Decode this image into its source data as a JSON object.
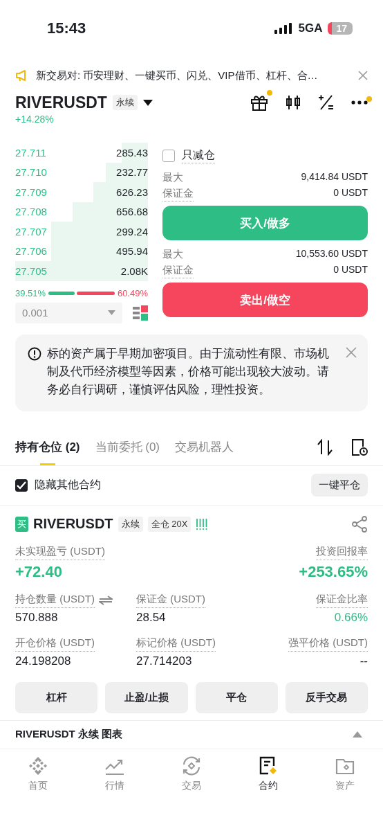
{
  "status_bar": {
    "time": "15:43",
    "network": "5GA",
    "battery": "17"
  },
  "announcement": {
    "text": "新交易对: 币安理财、一键买币、闪兑、VIP借币、杠杆、合…"
  },
  "header": {
    "symbol": "RIVERUSDT",
    "tag": "永续",
    "change": "+14.28%",
    "actions": [
      {
        "dot": true
      },
      {
        "dot": false
      },
      {
        "dot": false
      },
      {
        "dot": true
      }
    ]
  },
  "order_book": {
    "rows": [
      {
        "price": "27.711",
        "amount": "285.43"
      },
      {
        "price": "27.710",
        "amount": "232.77"
      },
      {
        "price": "27.709",
        "amount": "626.23"
      },
      {
        "price": "27.708",
        "amount": "656.68"
      },
      {
        "price": "27.707",
        "amount": "299.24"
      },
      {
        "price": "27.706",
        "amount": "495.94"
      },
      {
        "price": "27.705",
        "amount": "2.08K"
      }
    ],
    "buy_pct": "39.51%",
    "sell_pct": "60.49%",
    "ratio": {
      "level": 0.3951
    },
    "precision": "0.001"
  },
  "order_form": {
    "reduce_only": {
      "label": "只减仓",
      "checked": false
    },
    "sides": [
      {
        "kind": "buy",
        "max_label": "最大",
        "max_value": "9,414.84 USDT",
        "margin_label": "保证金",
        "margin_value": "0 USDT",
        "button": "买入/做多"
      },
      {
        "kind": "sell",
        "max_label": "最大",
        "max_value": "10,553.60 USDT",
        "margin_label": "保证金",
        "margin_value": "0 USDT",
        "button": "卖出/做空"
      }
    ]
  },
  "notice": {
    "text": "标的资产属于早期加密项目。由于流动性有限、市场机制及代币经济模型等因素，价格可能出现较大波动。请务必自行调研，谨慎评估风险，理性投资。"
  },
  "tabs": [
    {
      "label": "持有仓位 (2)",
      "selected": true
    },
    {
      "label": "当前委托 (0)",
      "selected": false
    },
    {
      "label": "交易机器人",
      "selected": false
    }
  ],
  "hide_others": {
    "label": "隐藏其他合约",
    "checked": true
  },
  "close_all_button": "一键平仓",
  "position": {
    "side": "买",
    "symbol": "RIVERUSDT",
    "tags": [
      "永续",
      "全仓 20X"
    ],
    "rows": [
      [
        {
          "label": "未实现盈亏 (USDT)",
          "value": "+72.40",
          "positive": true,
          "kind": "large",
          "swap": false
        },
        "",
        {
          "label": "投资回报率",
          "value": "+253.65%",
          "positive": true,
          "kind": "large",
          "swap": false
        }
      ],
      [
        {
          "label": "持仓数量 (USDT)",
          "value": "570.888",
          "positive": false,
          "kind": "normal",
          "swap": true
        },
        {
          "label": "保证金 (USDT)",
          "value": "28.54",
          "positive": false,
          "kind": "normal",
          "swap": false
        },
        {
          "label": "保证金比率",
          "value": "0.66%",
          "positive": true,
          "kind": "normal",
          "swap": false
        }
      ],
      [
        {
          "label": "开仓价格 (USDT)",
          "value": "24.198208",
          "positive": false,
          "kind": "normal",
          "swap": false
        },
        {
          "label": "标记价格 (USDT)",
          "value": "27.714203",
          "positive": false,
          "kind": "normal",
          "swap": false
        },
        {
          "label": "强平价格 (USDT)",
          "value": "--",
          "positive": false,
          "kind": "normal",
          "swap": false
        }
      ]
    ],
    "actions": [
      "杠杆",
      "止盈/止损",
      "平仓",
      "反手交易"
    ]
  },
  "chart_bar": {
    "text": "RIVERUSDT 永续 图表"
  },
  "bottom_nav": [
    {
      "label": "首页",
      "selected": false
    },
    {
      "label": "行情",
      "selected": false
    },
    {
      "label": "交易",
      "selected": false
    },
    {
      "label": "合约",
      "selected": true
    },
    {
      "label": "资产",
      "selected": false
    }
  ]
}
